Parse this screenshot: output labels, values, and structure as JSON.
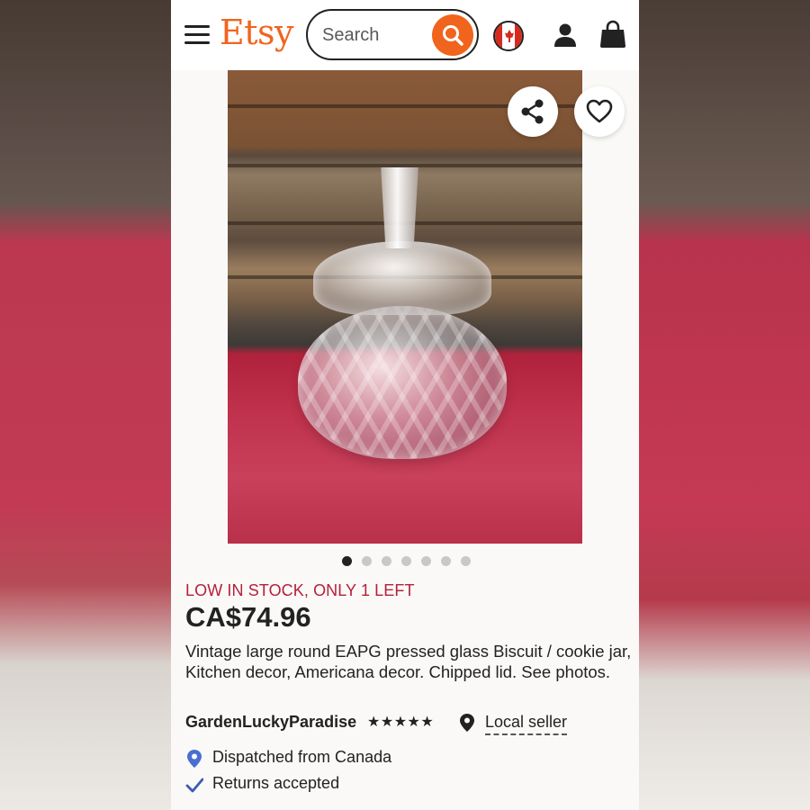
{
  "header": {
    "logo": "Etsy",
    "search": {
      "placeholder": "Search"
    },
    "icons": [
      "menu-icon",
      "search-icon",
      "canada-flag-icon",
      "user-icon",
      "shopping-bag-icon"
    ]
  },
  "product": {
    "image_actions": {
      "share_icon": "share-icon",
      "favorite_icon": "heart-icon"
    },
    "carousel": {
      "total": 7,
      "active_index": 0
    },
    "stock_notice": "LOW IN STOCK, ONLY 1 LEFT",
    "price": "CA$74.96",
    "title": "Vintage large round EAPG pressed glass Biscuit / cookie jar, Kitchen decor, Americana decor. Chipped lid. See photos.",
    "seller": {
      "shop_name": "GardenLuckyParadise",
      "rating_stars": "★★★★★",
      "rating": 5,
      "badge": "Local seller"
    },
    "features": [
      {
        "icon": "location-pin-icon",
        "label": "Dispatched from Canada"
      },
      {
        "icon": "checkmark-icon",
        "label": "Returns accepted"
      }
    ]
  },
  "colors": {
    "brand": "#f1641e",
    "stock_alert": "#b4203c",
    "text": "#222222",
    "pin_blue": "#4a6fd1",
    "check_blue": "#3b5bb5"
  }
}
